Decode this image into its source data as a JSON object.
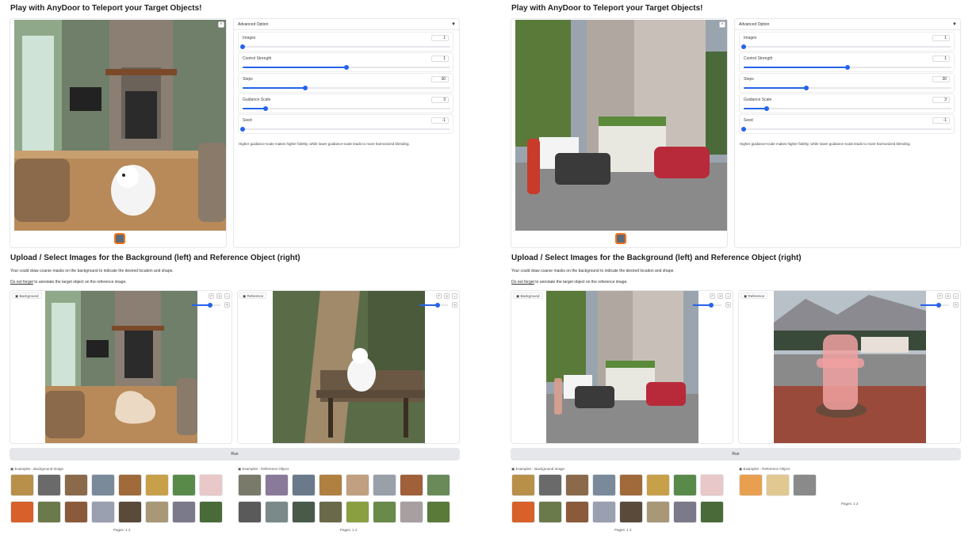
{
  "left": {
    "title": "Play with AnyDoor to Teleport your Target Objects!",
    "advanced_header": "Advanced Option",
    "sliders": [
      {
        "label": "Images",
        "value": "1",
        "fraction": 0.0
      },
      {
        "label": "Control Strength",
        "value": "1",
        "fraction": 0.5
      },
      {
        "label": "Steps",
        "value": "30",
        "fraction": 0.3
      },
      {
        "label": "Guidance Scale",
        "value": "3",
        "fraction": 0.11
      },
      {
        "label": "Seed",
        "value": "-1",
        "fraction": 0.0
      }
    ],
    "note": "Higher guidance-scale makes higher fidelity, while lower guidance-scale leads to more harmonized blending.",
    "section_title": "Upload / Select Images for the Background (left) and Reference Object (right)",
    "hint1": "Your could draw coarse masks on the background to indicate the desired location and shape.",
    "hint2_underlined": "Do not forget",
    "hint2_rest": " to annotate the target object on the reference image.",
    "bg_tag": "Background",
    "ref_tag": "Reference",
    "run_label": "Run",
    "examples_bg_label": "Examples - Background Image",
    "examples_ref_label": "Examples - Reference Object",
    "pages_bg": "Pages: 1 2",
    "pages_ref": "Pages: 1 2"
  },
  "right": {
    "title": "Play with AnyDoor to Teleport your Target Objects!",
    "advanced_header": "Advanced Option",
    "sliders": [
      {
        "label": "Images",
        "value": "1",
        "fraction": 0.0
      },
      {
        "label": "Control Strength",
        "value": "1",
        "fraction": 0.5
      },
      {
        "label": "Steps",
        "value": "30",
        "fraction": 0.3
      },
      {
        "label": "Guidance Scale",
        "value": "3",
        "fraction": 0.11
      },
      {
        "label": "Seed",
        "value": "-1",
        "fraction": 0.0
      }
    ],
    "note": "Higher guidance-scale makes higher fidelity, while lower guidance-scale leads to more harmonized blending.",
    "section_title": "Upload / Select Images for the Background (left) and Reference Object (right)",
    "hint1": "Your could draw coarse masks on the background to indicate the desired location and shape.",
    "hint2_underlined": "Do not forget",
    "hint2_rest": " to annotate the target object on the reference image.",
    "bg_tag": "Background",
    "ref_tag": "Reference",
    "run_label": "Run",
    "examples_bg_label": "Examples - Background Image",
    "examples_ref_label": "Examples - Reference Object",
    "pages_bg": "Pages: 1 2",
    "pages_ref": "Pages: 1 2"
  },
  "colors": {
    "accent": "#2563eb",
    "thumb_border": "#f97316",
    "run_bg": "#e5e7eb"
  },
  "icons": [
    "close-icon",
    "chevron-down-icon",
    "undo-icon",
    "redo-icon",
    "clear-icon",
    "brush-icon",
    "image-icon"
  ]
}
